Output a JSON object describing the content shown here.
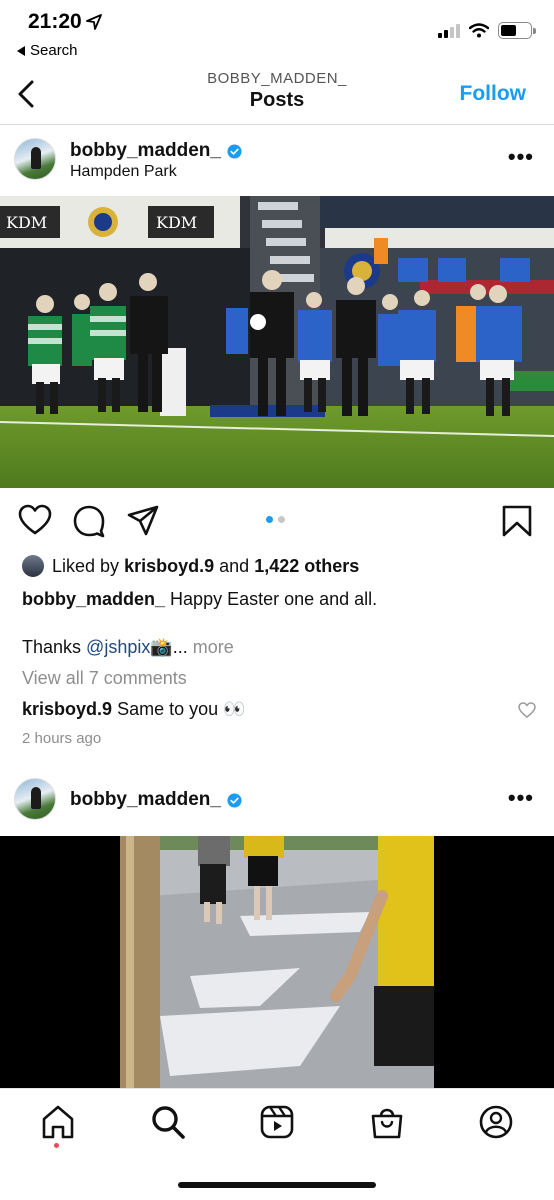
{
  "status_bar": {
    "time": "21:20",
    "back_label": "Search"
  },
  "header": {
    "username": "BOBBY_MADDEN_",
    "title": "Posts",
    "follow_label": "Follow"
  },
  "post": {
    "username": "bobby_madden_",
    "location": "Hampden Park",
    "more_icon": "more-horizontal-icon",
    "image_sign": "KDM",
    "carousel": {
      "count": 2,
      "active": 1
    },
    "likes": {
      "prefix": "Liked by",
      "user": "krisboyd.9",
      "joiner": "and",
      "others": "1,422 others"
    },
    "caption": {
      "username": "bobby_madden_",
      "text": "Happy Easter one and all.",
      "line2_prefix": "Thanks",
      "mention": "@jshpix",
      "line2_suffix": "📸...",
      "more": "more"
    },
    "view_comments": "View all 7 comments",
    "comment": {
      "username": "krisboyd.9",
      "text": "Same to you 👀"
    },
    "time_ago": "2 hours ago"
  },
  "post2": {
    "username": "bobby_madden_"
  },
  "tabbar": {
    "items": [
      "home-icon",
      "search-icon",
      "reels-icon",
      "shop-icon",
      "profile-icon"
    ]
  },
  "colors": {
    "accent": "#1a9cf0",
    "mention": "#224a7a",
    "muted": "#8e8e8e",
    "notification": "#ed4956"
  }
}
